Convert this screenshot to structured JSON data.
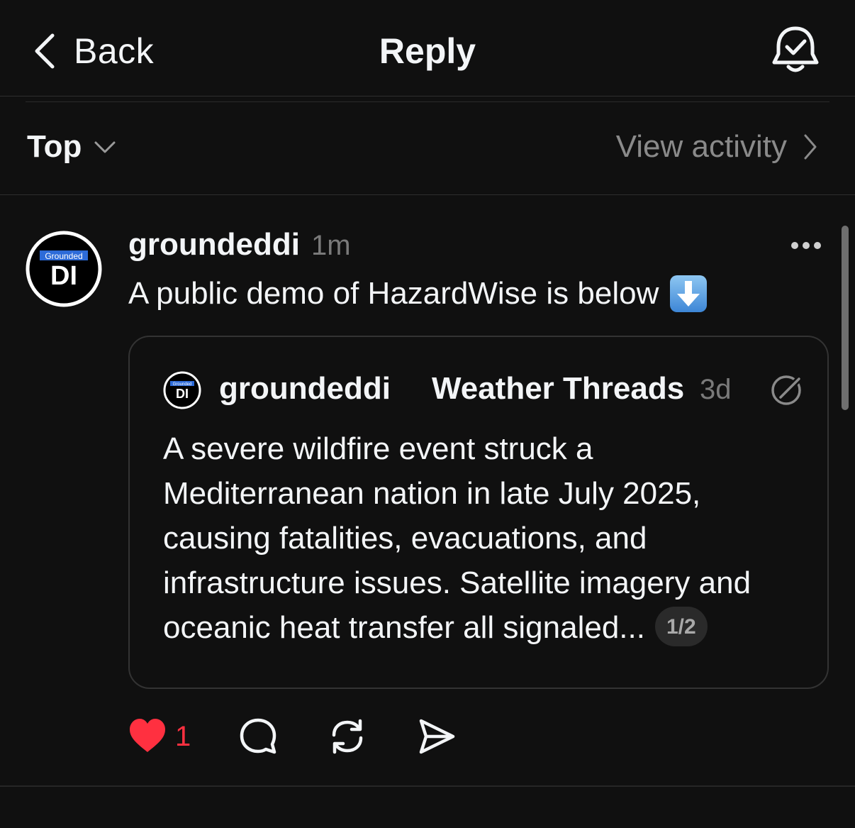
{
  "header": {
    "back_label": "Back",
    "title": "Reply",
    "back_icon": "chevron-left-icon",
    "bell_icon": "bell-check-icon"
  },
  "sort": {
    "selected": "Top",
    "view_activity": "View activity"
  },
  "post": {
    "avatar": {
      "top_text": "Grounded",
      "main_text": "DI"
    },
    "username": "groundeddi",
    "time": "1m",
    "text": "A public demo of HazardWise is below",
    "emoji": "down-arrow-emoji"
  },
  "quote": {
    "avatar": {
      "top_text": "Grounded",
      "main_text": "DI"
    },
    "username": "groundeddi",
    "community": "Weather Threads",
    "time": "3d",
    "lines": [
      "A severe wildfire event struck a",
      "Mediterranean nation in late July 2025,",
      "causing fatalities, evacuations, and",
      "infrastructure issues. Satellite imagery and",
      "oceanic heat transfer all signaled..."
    ],
    "pager": "1/2"
  },
  "actions": {
    "like_count": "1",
    "like_color": "#ff3040"
  },
  "colors": {
    "background": "#101010",
    "text": "#f3f5f7",
    "muted": "#7a7a7a",
    "accent_blue": "#2d6bd8"
  }
}
